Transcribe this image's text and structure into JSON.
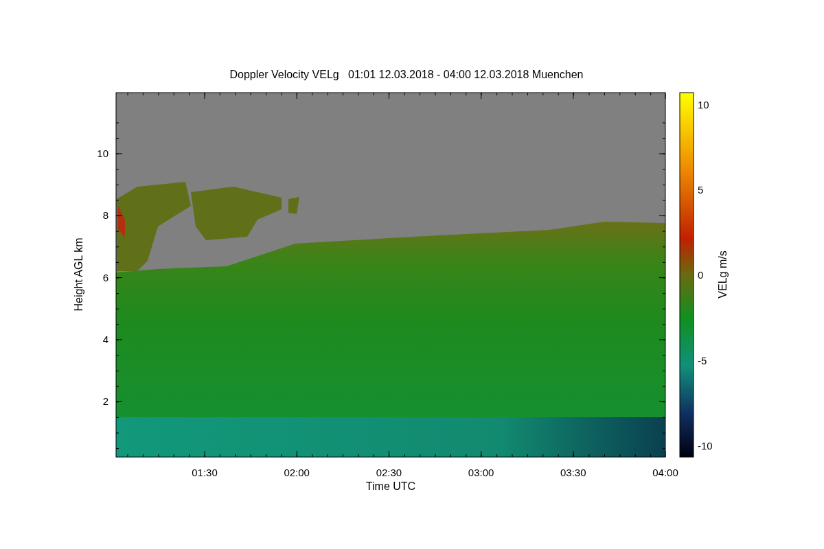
{
  "title": "Doppler Velocity VELg   01:01 12.03.2018 - 04:00 12.03.2018 Muenchen",
  "y_axis": {
    "label": "Height AGL km",
    "ticks": [
      "10",
      "8",
      "6",
      "4",
      "2"
    ]
  },
  "x_axis": {
    "label": "Time UTC",
    "ticks": [
      "01:30",
      "02:00",
      "02:30",
      "03:00",
      "03:30",
      "04:00"
    ]
  },
  "colorbar": {
    "label": "VELg m/s",
    "ticks": [
      "10",
      "5",
      "0",
      "-5",
      "-10"
    ]
  }
}
